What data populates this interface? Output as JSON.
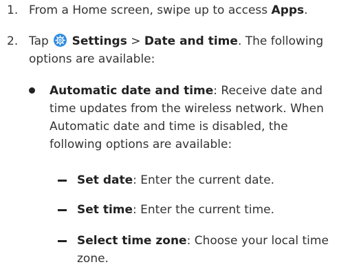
{
  "steps": [
    {
      "num": "1.",
      "pre": "From a Home screen, swipe up to access ",
      "bold": "Apps",
      "post": "."
    },
    {
      "num": "2.",
      "pre": "Tap ",
      "settings": "Settings",
      "sep": " > ",
      "date_time": "Date and time",
      "post": ". The following options are available:",
      "icon": "settings-gear-icon"
    }
  ],
  "bullet": {
    "title": "Automatic date and time",
    "desc": ": Receive date and time updates from the wireless network. When Automatic date and time is disabled, the following options are available:"
  },
  "subitems": [
    {
      "title": "Set date",
      "desc": ": Enter the current date."
    },
    {
      "title": "Set time",
      "desc": ": Enter the current time."
    },
    {
      "title": "Select time zone",
      "desc": ": Choose your local time zone."
    }
  ],
  "colors": {
    "text": "#333333",
    "icon": "#2e8ce0"
  }
}
